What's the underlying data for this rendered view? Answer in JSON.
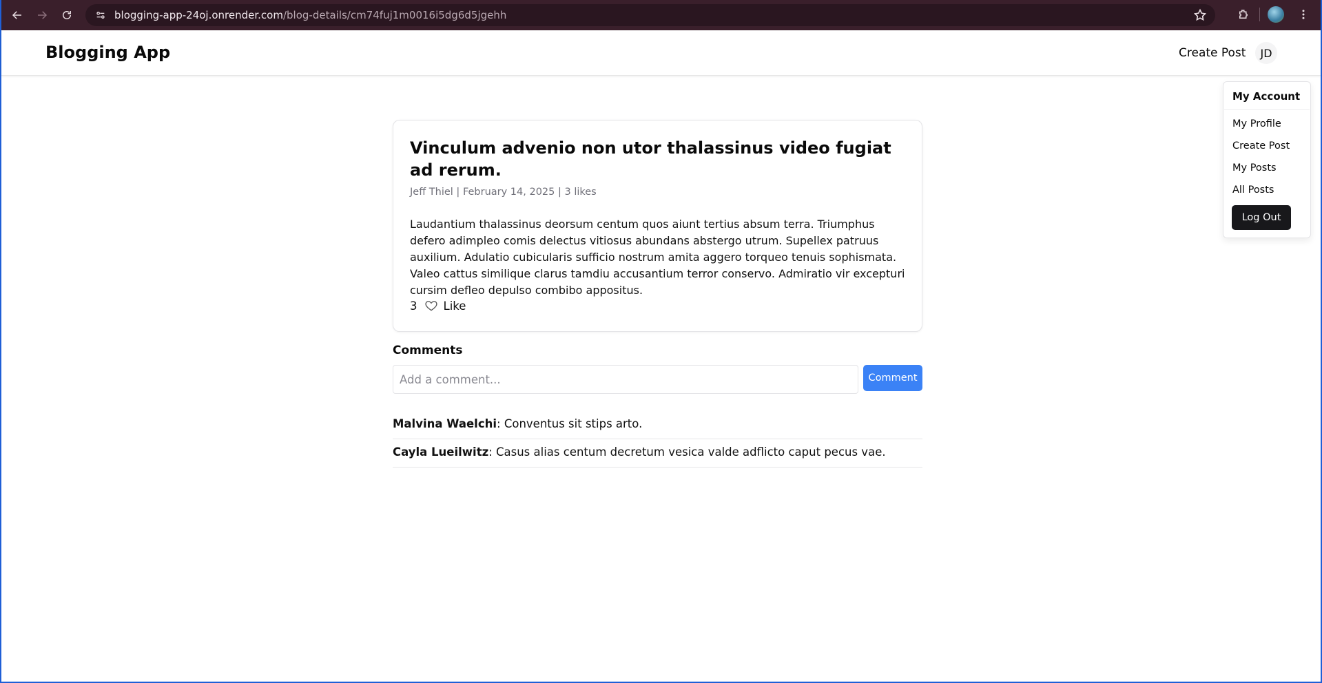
{
  "browser": {
    "url_host": "blogging-app-24oj.onrender.com",
    "url_path": "/blog-details/cm74fuj1m0016i5dg6d5jgehh"
  },
  "header": {
    "brand": "Blogging App",
    "create_post": "Create Post",
    "avatar_initials": "JD"
  },
  "account_menu": {
    "title": "My Account",
    "items": [
      "My Profile",
      "Create Post",
      "My Posts",
      "All Posts"
    ],
    "logout": "Log Out"
  },
  "post": {
    "title": "Vinculum advenio non utor thalassinus video fugiat ad rerum.",
    "author": "Jeff Thiel",
    "date": "February 14, 2025",
    "likes_text": "3 likes",
    "body": "Laudantium thalassinus deorsum centum quos aiunt tertius absum terra. Triumphus defero adimpleo comis delectus vitiosus abundans abstergo utrum. Supellex patruus auxilium. Adulatio cubicularis sufficio nostrum amita aggero torqueo tenuis sophismata. Valeo cattus similique clarus tamdiu accusantium terror conservo. Admiratio vir excepturi cursim defleo depulso combibo appositus.",
    "like_count": "3",
    "like_label": "Like"
  },
  "comments": {
    "title": "Comments",
    "placeholder": "Add a comment...",
    "input_value": "",
    "button": "Comment",
    "list": [
      {
        "author": "Malvina Waelchi",
        "text": ": Conventus sit stips arto."
      },
      {
        "author": "Cayla Lueilwitz",
        "text": ": Casus alias centum decretum vesica valde adflicto caput pecus vae."
      }
    ]
  },
  "colors": {
    "chrome_bg": "#3a1f2b",
    "accent_blue": "#3b82f6",
    "logout_bg": "#18181b"
  }
}
